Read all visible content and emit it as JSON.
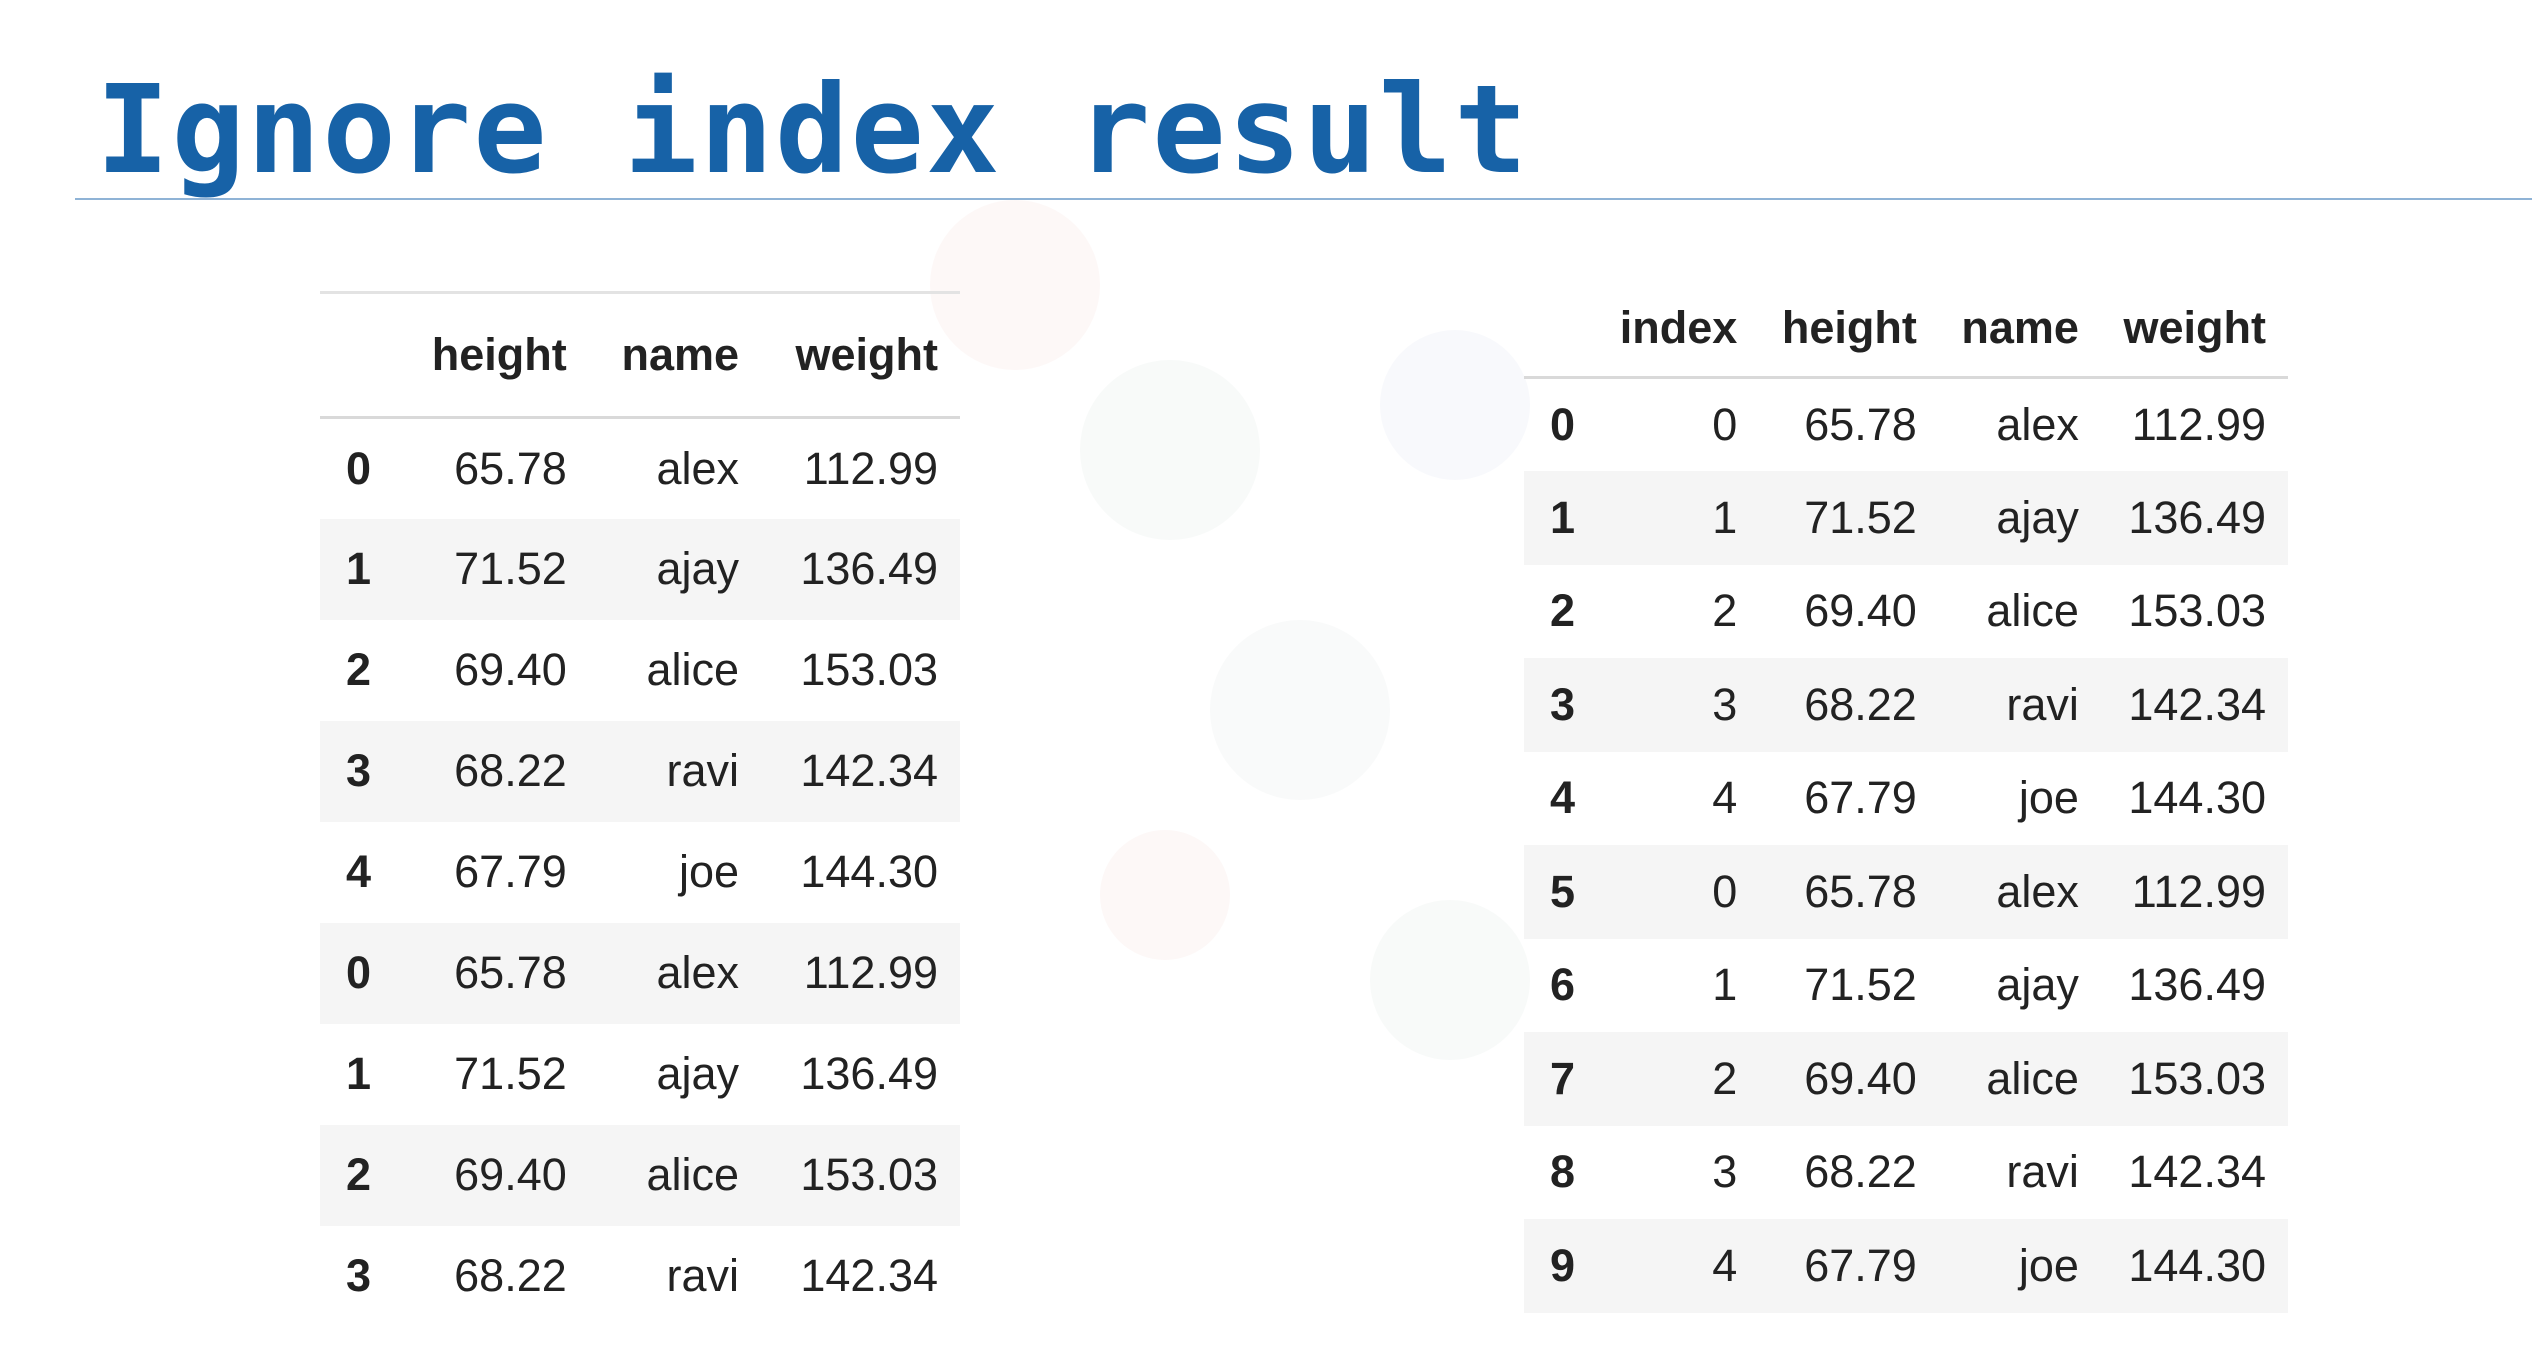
{
  "slide": {
    "title": "Ignore index result"
  },
  "colors": {
    "title": "#1762a7",
    "rule": "#8fb3d6",
    "stripe": "#f5f5f5"
  },
  "left_table": {
    "columns": [
      "",
      "height",
      "name",
      "weight"
    ],
    "rows": [
      {
        "index": "0",
        "height": "65.78",
        "name": "alex",
        "weight": "112.99"
      },
      {
        "index": "1",
        "height": "71.52",
        "name": "ajay",
        "weight": "136.49"
      },
      {
        "index": "2",
        "height": "69.40",
        "name": "alice",
        "weight": "153.03"
      },
      {
        "index": "3",
        "height": "68.22",
        "name": "ravi",
        "weight": "142.34"
      },
      {
        "index": "4",
        "height": "67.79",
        "name": "joe",
        "weight": "144.30"
      },
      {
        "index": "0",
        "height": "65.78",
        "name": "alex",
        "weight": "112.99"
      },
      {
        "index": "1",
        "height": "71.52",
        "name": "ajay",
        "weight": "136.49"
      },
      {
        "index": "2",
        "height": "69.40",
        "name": "alice",
        "weight": "153.03"
      },
      {
        "index": "3",
        "height": "68.22",
        "name": "ravi",
        "weight": "142.34"
      }
    ]
  },
  "right_table": {
    "columns": [
      "",
      "index",
      "height",
      "name",
      "weight"
    ],
    "rows": [
      {
        "row": "0",
        "index": "0",
        "height": "65.78",
        "name": "alex",
        "weight": "112.99"
      },
      {
        "row": "1",
        "index": "1",
        "height": "71.52",
        "name": "ajay",
        "weight": "136.49"
      },
      {
        "row": "2",
        "index": "2",
        "height": "69.40",
        "name": "alice",
        "weight": "153.03"
      },
      {
        "row": "3",
        "index": "3",
        "height": "68.22",
        "name": "ravi",
        "weight": "142.34"
      },
      {
        "row": "4",
        "index": "4",
        "height": "67.79",
        "name": "joe",
        "weight": "144.30"
      },
      {
        "row": "5",
        "index": "0",
        "height": "65.78",
        "name": "alex",
        "weight": "112.99"
      },
      {
        "row": "6",
        "index": "1",
        "height": "71.52",
        "name": "ajay",
        "weight": "136.49"
      },
      {
        "row": "7",
        "index": "2",
        "height": "69.40",
        "name": "alice",
        "weight": "153.03"
      },
      {
        "row": "8",
        "index": "3",
        "height": "68.22",
        "name": "ravi",
        "weight": "142.34"
      },
      {
        "row": "9",
        "index": "4",
        "height": "67.79",
        "name": "joe",
        "weight": "144.30"
      }
    ]
  }
}
